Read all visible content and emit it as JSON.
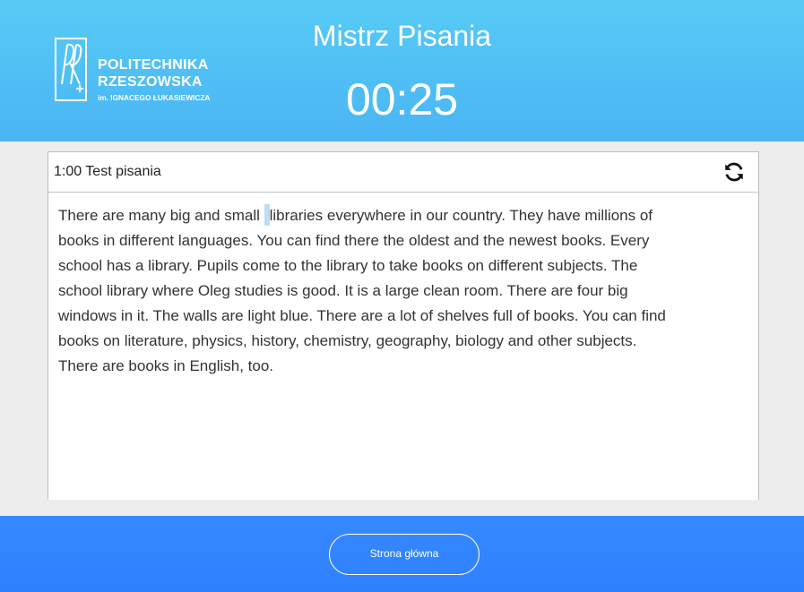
{
  "header": {
    "logo": {
      "line1": "POLITECHNIKA",
      "line2": "RZESZOWSKA",
      "line3": "im. IGNACEGO ŁUKASIEWICZA"
    },
    "title": "Mistrz Pisania",
    "timer": "00:25"
  },
  "panel": {
    "title": "1:00 Test pisania",
    "refresh_icon": "refresh-icon",
    "text_before_cursor": "There are many big and small",
    "text_after_cursor": "libraries everywhere in our country. They have millions of",
    "lines": [
      "books in different languages. You can find there the oldest and the newest books. Every",
      "school has a library. Pupils come to the library to take books on different subjects. The",
      "school library where Oleg studies is good. It is a large clean room. There are four big",
      "windows in it. The walls are light blue. There are a lot of shelves full of books. You can find",
      "books on literature, physics, history, chemistry, geography, biology and other subjects.",
      "There are books in English, too."
    ]
  },
  "footer": {
    "home_button": "Strona główna"
  }
}
